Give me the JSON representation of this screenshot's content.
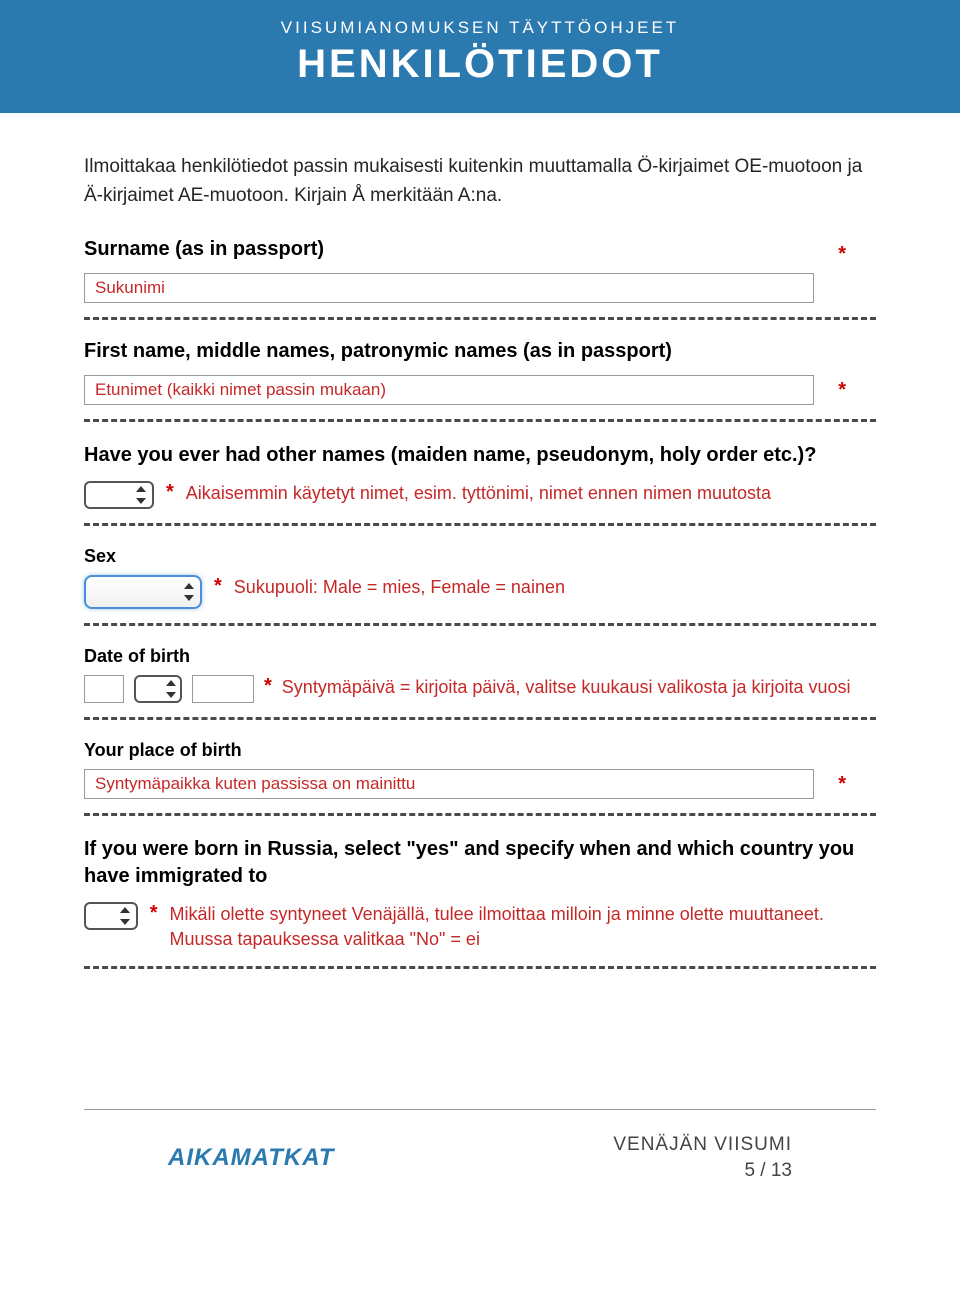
{
  "header": {
    "sub": "VIISUMIANOMUKSEN TÄYTTÖOHJEET",
    "title": "HENKILÖTIEDOT"
  },
  "intro": "Ilmoittakaa henkilötiedot passin mukaisesti kuitenkin muuttamalla Ö-kirjaimet OE-muotoon ja Ä-kirjaimet AE-muotoon. Kirjain Å merkitään A:na.",
  "fields": {
    "surname_label": "Surname (as in passport)",
    "surname_value": "Sukunimi",
    "firstname_label": "First name, middle names, patronymic names (as in passport)",
    "firstname_value": "Etunimet (kaikki nimet passin mukaan)",
    "othernames_label": "Have you ever had other names (maiden name, pseudonym, holy order etc.)?",
    "othernames_note": "Aikaisemmin käytetyt nimet, esim. tyttönimi, nimet ennen nimen muutosta",
    "sex_label": "Sex",
    "sex_note": "Sukupuoli: Male = mies, Female = nainen",
    "dob_label": "Date of birth",
    "dob_note": "Syntymäpäivä = kirjoita päivä, valitse kuukausi valikosta ja kirjoita vuosi",
    "pob_label": "Your place of birth",
    "pob_value": "Syntymäpaikka kuten passissa on mainittu",
    "russia_label": "If you were born in Russia, select \"yes\" and specify when and which country you have immigrated to",
    "russia_note": "Mikäli olette syntyneet Venäjällä, tulee ilmoittaa milloin ja minne olette muuttaneet. Muussa tapauksessa valitkaa \"No\" = ei"
  },
  "footer": {
    "logo": "AIKAMATKAT",
    "right1": "VENÄJÄN VIISUMI",
    "right2": "5 / 13"
  }
}
